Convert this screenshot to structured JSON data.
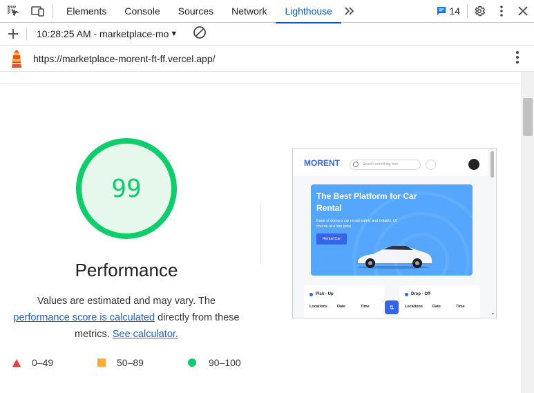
{
  "devtools": {
    "tabs": [
      {
        "label": "Elements"
      },
      {
        "label": "Console"
      },
      {
        "label": "Sources"
      },
      {
        "label": "Network"
      },
      {
        "label": "Lighthouse"
      }
    ],
    "active_tab": "Lighthouse",
    "issues_count": "14"
  },
  "toolbar": {
    "report_label": "10:28:25 AM - marketplace-mo"
  },
  "urlbar": {
    "url": "https://marketplace-morent-ft-ff.vercel.app/"
  },
  "report": {
    "score": "99",
    "category": "Performance",
    "desc_prefix": "Values are estimated and may vary. The",
    "link_text": "performance score is calculated",
    "desc_middle": "directly from these metrics.",
    "calc_link": "See calculator.",
    "legend": [
      {
        "range": "0–49",
        "color": "#ff3333"
      },
      {
        "range": "50–89",
        "color": "#ffaa33"
      },
      {
        "range": "90–100",
        "color": "#0cce6b"
      }
    ],
    "score_color": "#0cce6b"
  },
  "screenshot": {
    "logo": "MORENT",
    "search_placeholder": "Search something here",
    "banner_title": "The Best Platform for Car Rental",
    "banner_sub": "Ease of doing a car rental safely and reliably. Of course at a low price.",
    "banner_button": "Rental Car",
    "pickup_label": "Pick - Up",
    "dropoff_label": "Drop - Off",
    "col_locations": "Locations",
    "col_date": "Date",
    "col_time": "Time"
  }
}
